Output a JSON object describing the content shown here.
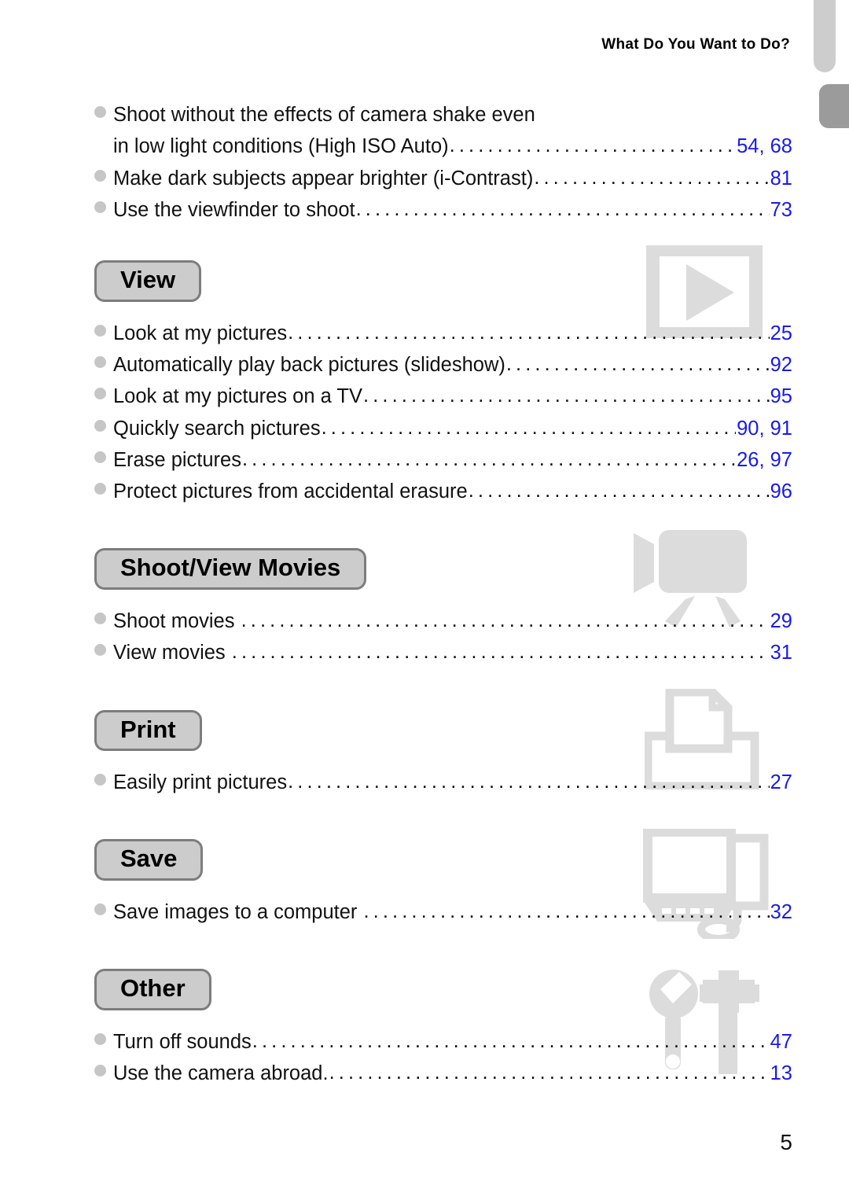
{
  "header": {
    "running_title": "What Do You Want to Do?"
  },
  "colors": {
    "page_number_blue": "#1a1ae6",
    "badge_fill": "#cccccc",
    "badge_border": "#7d7d7d",
    "bullet_gray": "#c6c6c6",
    "watermark_gray": "#dcdcdc",
    "tab_light": "#cdcdcd",
    "tab_dark": "#9b9b9b"
  },
  "intro_entries": [
    {
      "label": "Shoot without the effects of camera shake even",
      "label2": "in low light conditions (High ISO Auto)",
      "page": "54, 68"
    },
    {
      "label": "Make dark subjects appear brighter (i-Contrast)",
      "page": "81"
    },
    {
      "label": "Use the viewfinder to shoot",
      "page": "73"
    }
  ],
  "sections": [
    {
      "badge": "View",
      "icon": "play-button-icon",
      "entries": [
        {
          "label": "Look at my pictures",
          "page": "25"
        },
        {
          "label": "Automatically play back pictures (slideshow)",
          "page": "92"
        },
        {
          "label": "Look at my pictures on a TV",
          "page": "95"
        },
        {
          "label": "Quickly search pictures",
          "page": "90, 91"
        },
        {
          "label": "Erase pictures",
          "page": "26, 97"
        },
        {
          "label": "Protect pictures from accidental erasure",
          "page": "96"
        }
      ]
    },
    {
      "badge": "Shoot/View Movies",
      "icon": "camcorder-icon",
      "entries": [
        {
          "label": "Shoot movies ",
          "page": "29"
        },
        {
          "label": "View movies ",
          "page": "31"
        }
      ]
    },
    {
      "badge": "Print",
      "icon": "printer-icon",
      "entries": [
        {
          "label": "Easily print pictures",
          "page": "27"
        }
      ]
    },
    {
      "badge": "Save",
      "icon": "computer-icon",
      "entries": [
        {
          "label": "Save images to a computer ",
          "page": "32"
        }
      ]
    },
    {
      "badge": "Other",
      "icon": "tools-icon",
      "entries": [
        {
          "label": "Turn off sounds",
          "page": "47"
        },
        {
          "label": "Use the camera abroad.",
          "page": "13"
        }
      ]
    }
  ],
  "leader": "...........................................................................",
  "folio": "5"
}
